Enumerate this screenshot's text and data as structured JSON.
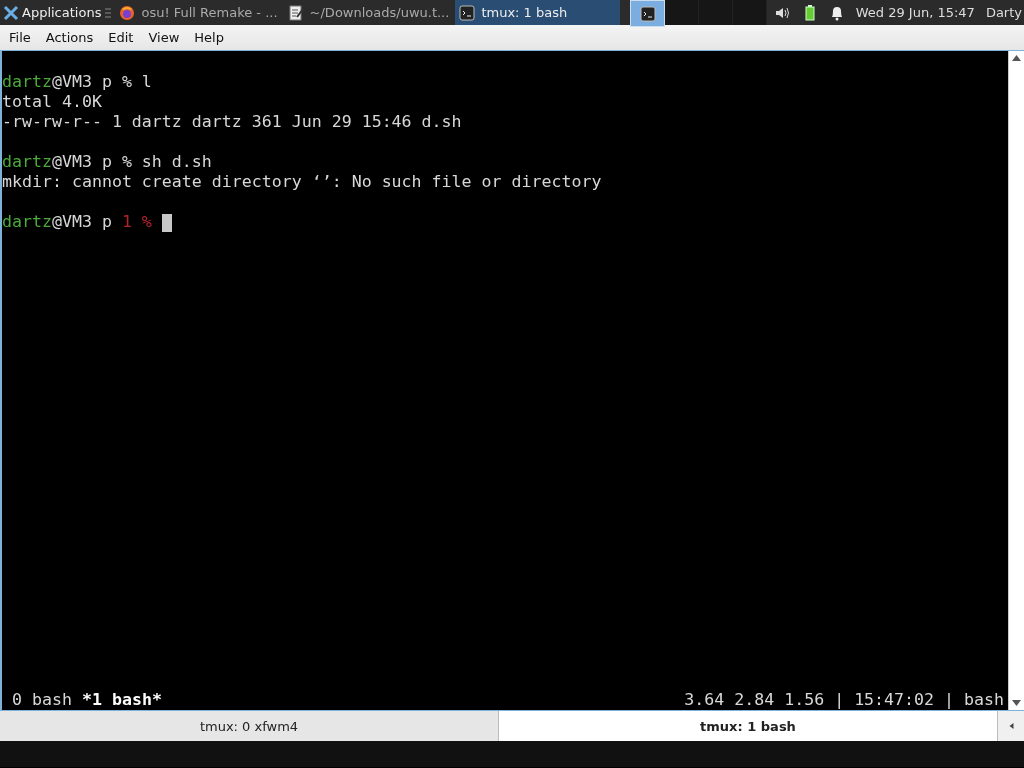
{
  "panel": {
    "apps_menu": "Applications",
    "tasks": [
      {
        "label": "osu! Full Remake - ...",
        "kind": "browser",
        "selected": false
      },
      {
        "label": "~/Downloads/uwu.t...",
        "kind": "editor",
        "selected": false
      },
      {
        "label": "tmux: 1 bash",
        "kind": "terminal",
        "selected": true
      }
    ],
    "workspaces": [
      {
        "selected": true
      },
      {
        "selected": false
      },
      {
        "selected": false
      },
      {
        "selected": false
      }
    ],
    "clock": "Wed 29 Jun, 15:47",
    "user": "Darty"
  },
  "menu": [
    "File",
    "Actions",
    "Edit",
    "View",
    "Help"
  ],
  "terminal": {
    "lines": [
      {
        "gap_before": true,
        "segments": [
          {
            "text": "dartz",
            "kind": "user"
          },
          {
            "text": "@VM3 p % l",
            "kind": "plain"
          }
        ]
      },
      {
        "segments": [
          {
            "text": "total 4.0K",
            "kind": "plain"
          }
        ]
      },
      {
        "segments": [
          {
            "text": "-rw-rw-r-- 1 dartz dartz 361 Jun 29 15:46 d.sh",
            "kind": "plain"
          }
        ]
      },
      {
        "gap_before": true,
        "segments": [
          {
            "text": "dartz",
            "kind": "user"
          },
          {
            "text": "@VM3 p % sh d.sh",
            "kind": "plain"
          }
        ]
      },
      {
        "segments": [
          {
            "text": "mkdir: cannot create directory ‘’: No such file or directory",
            "kind": "plain"
          }
        ]
      },
      {
        "gap_before": true,
        "cursor": true,
        "segments": [
          {
            "text": "dartz",
            "kind": "user"
          },
          {
            "text": "@VM3 p ",
            "kind": "plain"
          },
          {
            "text": "1 %",
            "kind": "error"
          }
        ]
      }
    ],
    "status": {
      "windows": [
        {
          "label": "0 bash",
          "selected": false
        },
        {
          "label": "*1 bash*",
          "selected": true
        }
      ],
      "right": "3.64 2.84 1.56 | 15:47:02 | bash"
    }
  },
  "tabs": [
    {
      "label": "tmux: 0 xfwm4",
      "selected": false
    },
    {
      "label": "tmux: 1 bash",
      "selected": true
    }
  ]
}
